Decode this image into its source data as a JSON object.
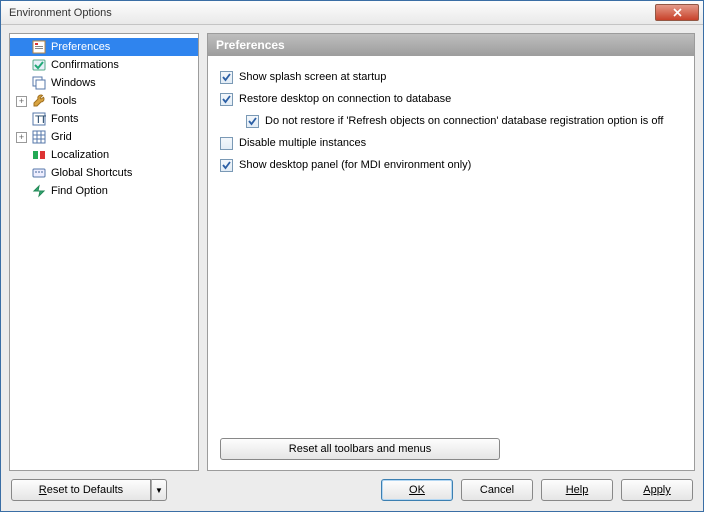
{
  "window": {
    "title": "Environment Options"
  },
  "tree": {
    "items": [
      {
        "label": "Preferences",
        "icon": "pref",
        "selected": true,
        "expandable": false
      },
      {
        "label": "Confirmations",
        "icon": "confirm",
        "selected": false,
        "expandable": false
      },
      {
        "label": "Windows",
        "icon": "windows",
        "selected": false,
        "expandable": false
      },
      {
        "label": "Tools",
        "icon": "tools",
        "selected": false,
        "expandable": true
      },
      {
        "label": "Fonts",
        "icon": "fonts",
        "selected": false,
        "expandable": false
      },
      {
        "label": "Grid",
        "icon": "grid",
        "selected": false,
        "expandable": true
      },
      {
        "label": "Localization",
        "icon": "local",
        "selected": false,
        "expandable": false
      },
      {
        "label": "Global Shortcuts",
        "icon": "shortcut",
        "selected": false,
        "expandable": false
      },
      {
        "label": "Find Option",
        "icon": "find",
        "selected": false,
        "expandable": false
      }
    ]
  },
  "panel": {
    "title": "Preferences",
    "checkboxes": [
      {
        "label": "Show splash screen at startup",
        "checked": true,
        "indent": false
      },
      {
        "label": "Restore desktop on connection to database",
        "checked": true,
        "indent": false
      },
      {
        "label": "Do not restore if 'Refresh objects on connection' database registration option is off",
        "checked": true,
        "indent": true
      },
      {
        "label": "Disable multiple instances",
        "checked": false,
        "indent": false
      },
      {
        "label": "Show desktop panel (for MDI environment only)",
        "checked": true,
        "indent": false
      }
    ],
    "reset_button": "Reset all toolbars and menus"
  },
  "buttons": {
    "reset_defaults": "Reset to Defaults",
    "ok": "OK",
    "cancel": "Cancel",
    "help": "Help",
    "apply": "Apply",
    "drop_arrow": "▼"
  }
}
